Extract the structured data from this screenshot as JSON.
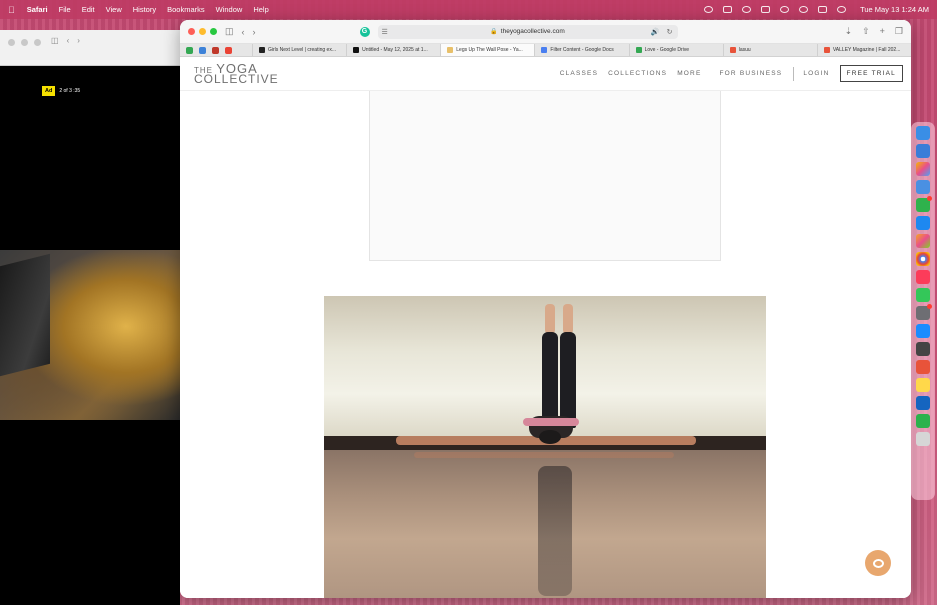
{
  "menubar": {
    "app": "Safari",
    "items": [
      "File",
      "Edit",
      "View",
      "History",
      "Bookmarks",
      "Window",
      "Help"
    ],
    "clock": "Tue May 13  1:24 AM"
  },
  "bg_window": {
    "ad_badge": "Ad",
    "ad_count": "2 of 3 :35"
  },
  "browser": {
    "url": "theyogacollective.com",
    "tabs": [
      {
        "label": "Girls Next Level | creating ex...",
        "color": "#222222"
      },
      {
        "label": "Untitled - May 12, 2025 at 1...",
        "color": "#111111"
      },
      {
        "label": "Legs Up The Wall Pose - Ya...",
        "color": "#e8c06a",
        "active": true
      },
      {
        "label": "Filter Content - Google Docs",
        "color": "#4a7ff0"
      },
      {
        "label": "Love - Google Drive",
        "color": "#34a853"
      },
      {
        "label": "lasuu",
        "color": "#e8533a"
      },
      {
        "label": "VALLEY Magazine | Fall 202...",
        "color": "#e8533a"
      }
    ]
  },
  "site": {
    "logo_the": "THE",
    "logo_yoga": "YOGA",
    "logo_collective": "COLLECTIVE",
    "nav": {
      "classes": "CLASSES",
      "collections": "COLLECTIONS",
      "more": "MORE",
      "business": "FOR BUSINESS",
      "login": "LOGIN",
      "trial": "FREE TRIAL"
    }
  },
  "colors": {
    "accent_help": "#e8a76e",
    "desktop": "#c2466e"
  }
}
